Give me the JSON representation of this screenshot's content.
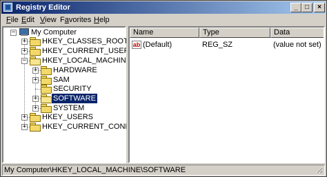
{
  "window": {
    "title": "Registry Editor"
  },
  "menu": [
    {
      "pre": "",
      "u": "F",
      "post": "ile"
    },
    {
      "pre": "",
      "u": "E",
      "post": "dit"
    },
    {
      "pre": "",
      "u": "V",
      "post": "iew"
    },
    {
      "pre": "F",
      "u": "a",
      "post": "vorites"
    },
    {
      "pre": "",
      "u": "H",
      "post": "elp"
    }
  ],
  "tree": {
    "root": "My Computer",
    "hkcr": "HKEY_CLASSES_ROOT",
    "hkcu": "HKEY_CURRENT_USER",
    "hklm": "HKEY_LOCAL_MACHINE",
    "hardware": "HARDWARE",
    "sam": "SAM",
    "security": "SECURITY",
    "software": "SOFTWARE",
    "system": "SYSTEM",
    "hku": "HKEY_USERS",
    "hkcc": "HKEY_CURRENT_CONFIG"
  },
  "list": {
    "columns": {
      "name": "Name",
      "type": "Type",
      "data": "Data"
    },
    "rows": [
      {
        "icon": "string-value-icon",
        "name": "(Default)",
        "type": "REG_SZ",
        "data": "(value not set)"
      }
    ]
  },
  "status": {
    "path": "My Computer\\HKEY_LOCAL_MACHINE\\SOFTWARE"
  },
  "colors": {
    "title_start": "#0a246a",
    "title_end": "#a6caf0",
    "selection": "#0a246a",
    "face": "#d4d0c8"
  }
}
